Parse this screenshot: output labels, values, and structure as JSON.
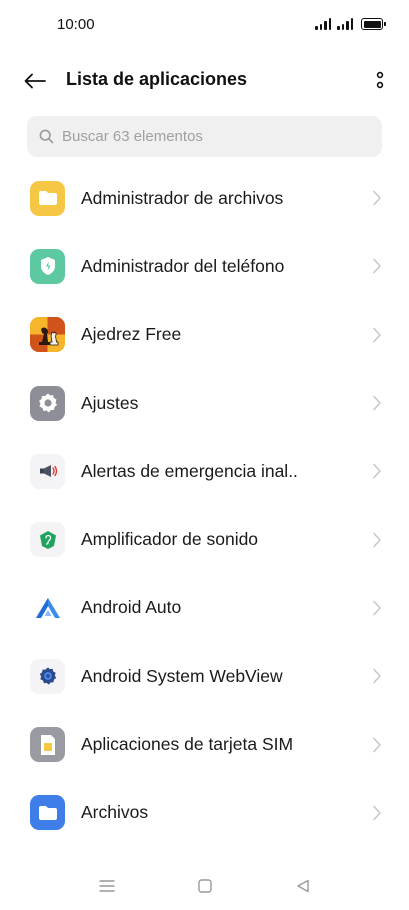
{
  "status_bar": {
    "time": "10:00"
  },
  "header": {
    "title": "Lista de aplicaciones"
  },
  "search": {
    "placeholder": "Buscar 63 elementos"
  },
  "apps": [
    {
      "label": "Administrador de archivos",
      "icon": "folder-icon",
      "color": "#f6c744"
    },
    {
      "label": "Administrador del teléfono",
      "icon": "shield-icon",
      "color": "#5cc9a0"
    },
    {
      "label": "Ajedrez Free",
      "icon": "chess-icon",
      "color": "#f29a1d"
    },
    {
      "label": "Ajustes",
      "icon": "gear-icon",
      "color": "#8e8e98"
    },
    {
      "label": "Alertas de emergencia inal..",
      "icon": "megaphone-icon",
      "color": "#f4f4f6"
    },
    {
      "label": "Amplificador de sonido",
      "icon": "ear-icon",
      "color": "#1fa35f"
    },
    {
      "label": "Android Auto",
      "icon": "android-auto-icon",
      "color": "#3b8cf0"
    },
    {
      "label": "Android System WebView",
      "icon": "webview-gear-icon",
      "color": "#2d4a8a"
    },
    {
      "label": "Aplicaciones de tarjeta SIM",
      "icon": "sim-card-icon",
      "color": "#9a9aa2"
    },
    {
      "label": "Archivos",
      "icon": "files-folder-icon",
      "color": "#3f7ee8"
    }
  ]
}
